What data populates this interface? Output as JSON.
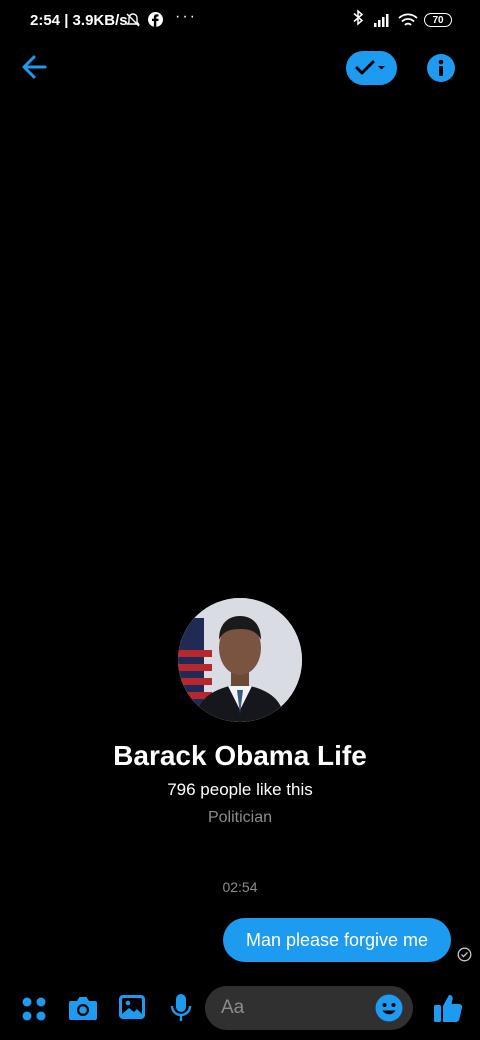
{
  "status_bar": {
    "time": "2:54 | 3.9KB/s",
    "overflow": "···",
    "battery": "70"
  },
  "profile": {
    "name": "Barack Obama Life",
    "likes": "796 people like this",
    "category": "Politician"
  },
  "conversation": {
    "timestamp": "02:54",
    "messages": [
      {
        "text": "Man please forgive me",
        "sent_by_me": true
      }
    ]
  },
  "composer": {
    "placeholder": "Aa"
  },
  "colors": {
    "accent": "#1d9bf0",
    "background": "#000000",
    "input_bg": "#303030",
    "muted_text": "#8a8d91"
  },
  "icons": [
    "back-arrow-icon",
    "checkmark-icon",
    "info-icon",
    "menu-dots-icon",
    "camera-icon",
    "gallery-icon",
    "microphone-icon",
    "emoji-icon",
    "thumbs-up-icon"
  ]
}
